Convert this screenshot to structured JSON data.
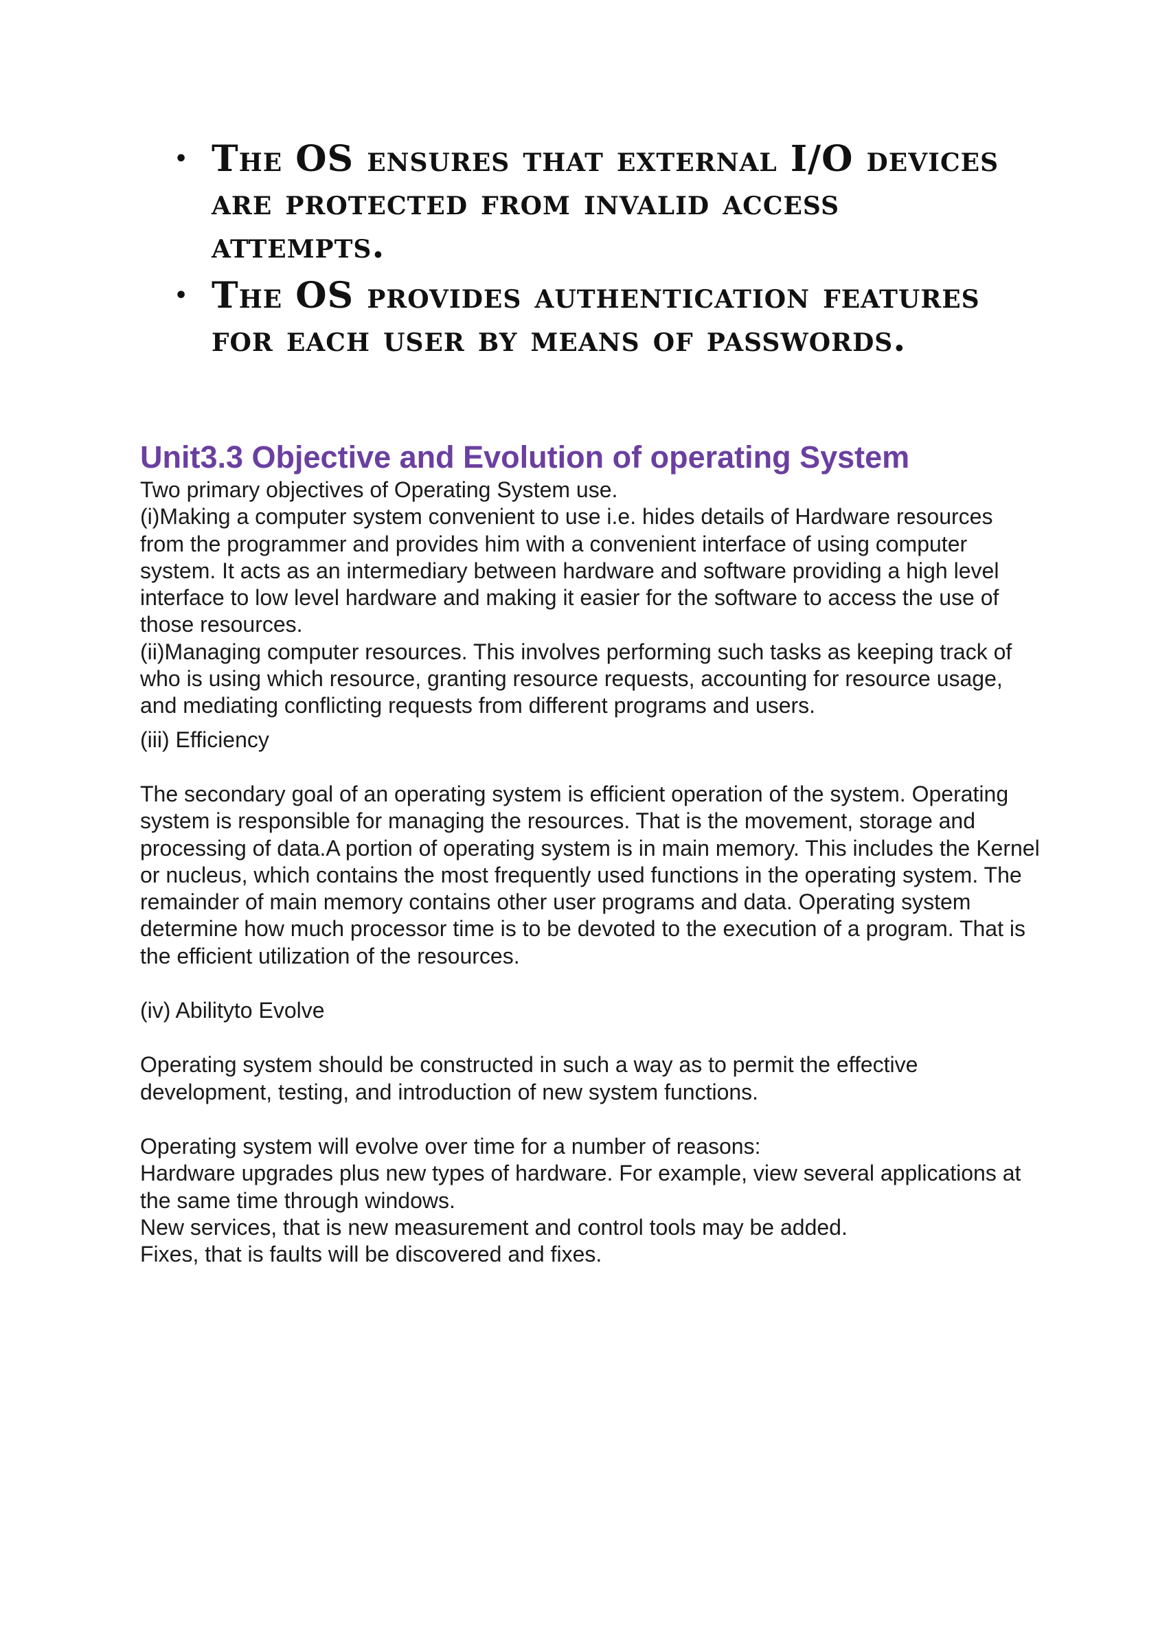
{
  "bullets": [
    "The OS ensures that external I/O devices are protected from invalid access attempts.",
    "The OS provides authentication features for each user by means of passwords."
  ],
  "bullet_marker": "•",
  "heading": "Unit3.3 Objective and Evolution of operating System",
  "paragraphs": [
    "Two primary objectives of Operating System use.",
    "(i)Making a computer system convenient to use i.e. hides details of Hardware resources from the programmer and provides him with a convenient interface of using computer system. It acts as an intermediary between hardware and software providing a high level interface to low level hardware and making it easier for the software to access the use of those resources.",
    "(ii)Managing computer resources. This involves performing such tasks as keeping track of who is using which resource, granting resource requests, accounting for resource usage, and mediating conflicting requests from different programs and users.",
    "(iii) Efficiency",
    "The secondary goal of an operating system is efficient operation of the system. Operating system is responsible for managing the resources. That is the movement, storage and processing of data.A portion of operating system is in main memory. This includes the Kernel or nucleus, which contains the most frequently used functions in the operating system. The remainder of main memory contains other user programs and data. Operating system determine how much processor time is to be devoted to the execution of a program. That is the efficient utilization of the resources.",
    "(iv) Abilityto Evolve",
    "Operating system should be constructed in such a way as to permit the effective development, testing, and introduction of new system functions.",
    "Operating system will evolve over time for a number of reasons:",
    "Hardware upgrades plus new types of hardware. For example, view several applications at the same time through windows.",
    "New services, that is new measurement and control tools may be added.",
    "Fixes, that is faults will be discovered and fixes."
  ],
  "colors": {
    "heading": "#6b3fa0",
    "text": "#1a1a1a"
  }
}
